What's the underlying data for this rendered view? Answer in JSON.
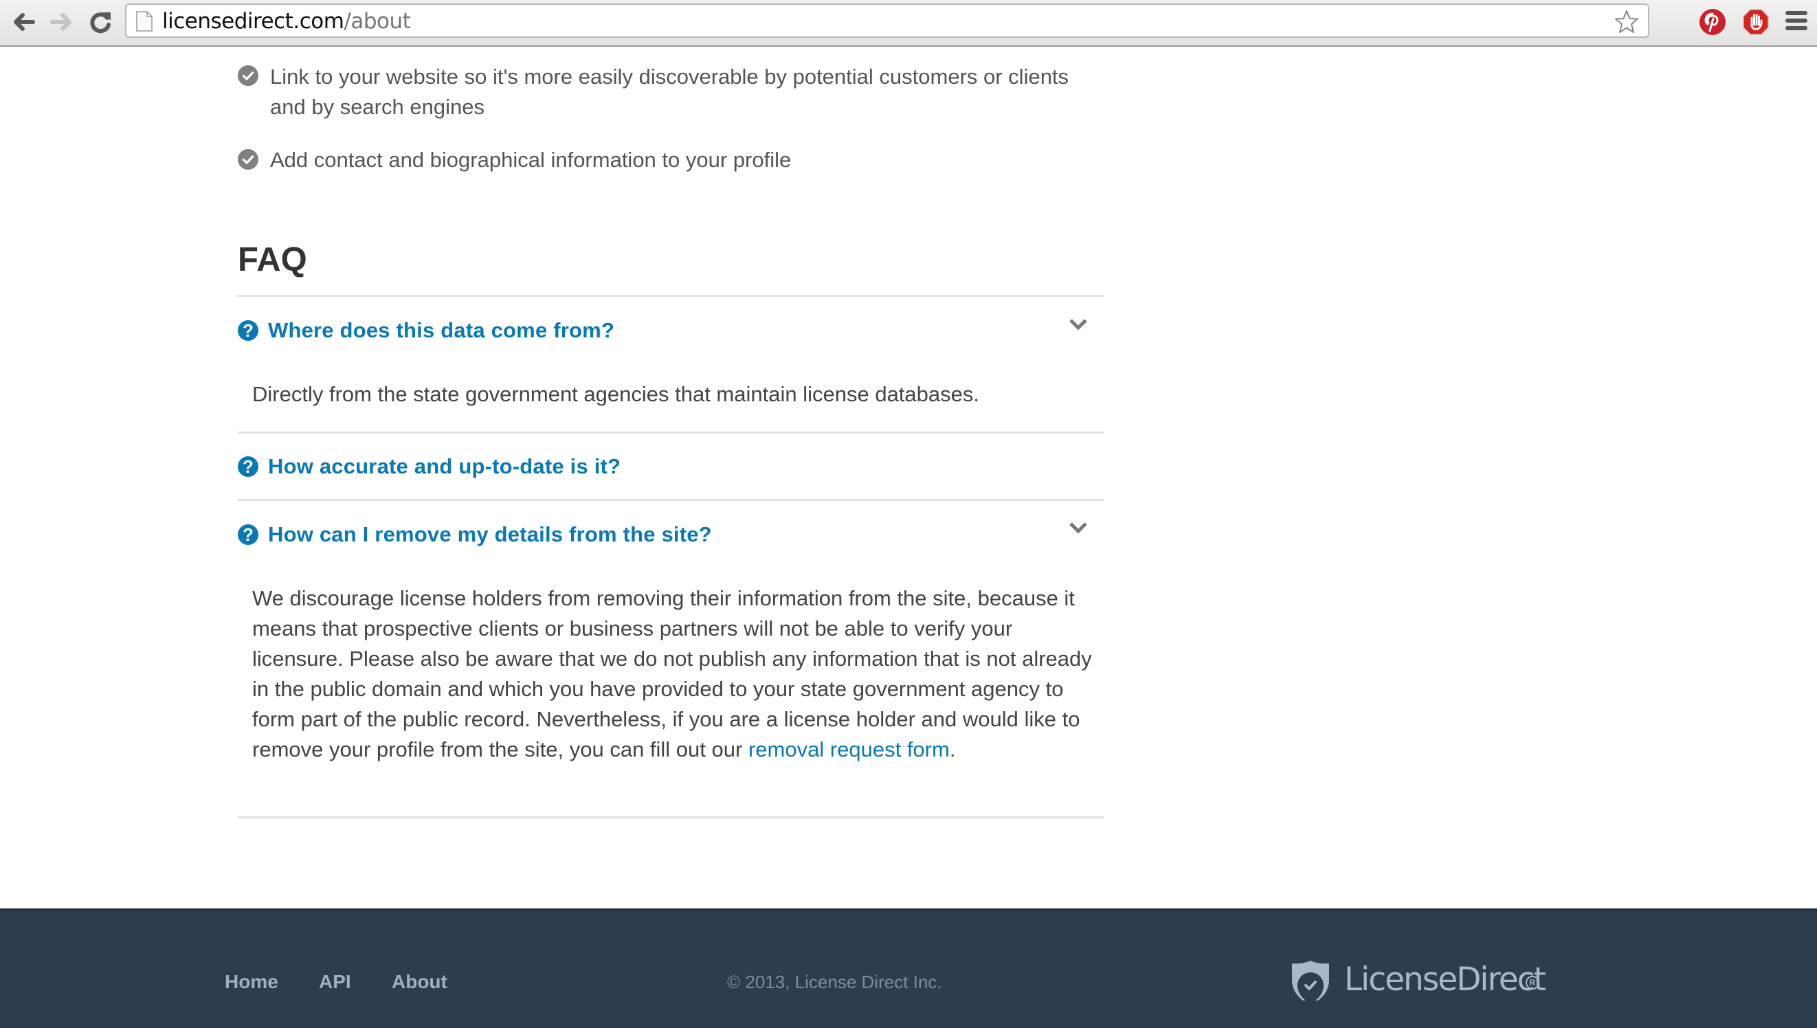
{
  "browser": {
    "url_host": "licensedirect.com",
    "url_path": "/about",
    "icons": [
      "back-arrow-icon",
      "forward-arrow-icon",
      "reload-icon",
      "page-icon",
      "bookmark-star-icon",
      "pinterest-icon",
      "adblock-icon",
      "menu-icon"
    ]
  },
  "features": {
    "items": [
      {
        "text": "Link to your website so it's more easily discoverable by potential customers or clients and by search engines",
        "icon": "check-circle-icon"
      },
      {
        "text": "Add contact and biographical information to your profile",
        "icon": "check-circle-icon"
      }
    ]
  },
  "faq": {
    "title": "FAQ",
    "items": [
      {
        "question": "Where does this data come from?",
        "expanded": true,
        "answer": "Directly from the state government agencies that maintain license databases."
      },
      {
        "question": "How accurate and up-to-date is it?",
        "expanded": false
      },
      {
        "question": "How can I remove my details from the site?",
        "expanded": true,
        "answer_before_link": "We discourage license holders from removing their information from the site, because it means that prospective clients or business partners will not be able to verify your licensure. Please also be aware that we do not publish any information that is not already in the public domain and which you have provided to your state government agency to form part of the public record. Nevertheless, if you are a license holder and would like to remove your profile from the site, you can fill out our ",
        "answer_link": "removal request form",
        "answer_after_link": "."
      }
    ]
  },
  "footer": {
    "links": [
      "Home",
      "API",
      "About"
    ],
    "copyright": "© 2013, License Direct Inc.",
    "logo_text": "LicenseDirect",
    "logo_mark": "®"
  },
  "colors": {
    "link_blue": "#0a78b4",
    "footer_bg": "#2e3c50",
    "footer_link": "#9fb0c4",
    "text": "#444444"
  }
}
